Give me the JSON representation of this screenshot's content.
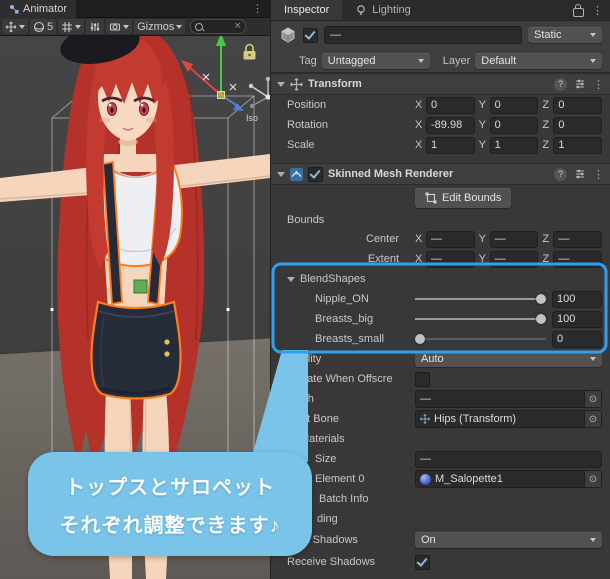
{
  "window": {
    "animator_tab": "Animator",
    "gizmos_label": "Gizmos",
    "toolbar_count": "5"
  },
  "scene": {
    "iso_label": "Iso",
    "bubble_line1": "トップスとサロペット",
    "bubble_line2": "それぞれ調整できます♪"
  },
  "icons": {
    "kebab": "⋮",
    "help": "?",
    "picker": "⊙",
    "close": "×"
  },
  "inspector": {
    "tab_inspector": "Inspector",
    "tab_lighting": "Lighting",
    "header": {
      "name": "—",
      "static": "Static",
      "tag_label": "Tag",
      "tag_value": "Untagged",
      "layer_label": "Layer",
      "layer_value": "Default"
    },
    "axes": {
      "x": "X",
      "y": "Y",
      "z": "Z"
    },
    "transform": {
      "title": "Transform",
      "position": {
        "label": "Position",
        "x": "0",
        "y": "0",
        "z": "0"
      },
      "rotation": {
        "label": "Rotation",
        "x": "-89.98",
        "y": "0",
        "z": "0"
      },
      "scale": {
        "label": "Scale",
        "x": "1",
        "y": "1",
        "z": "1"
      }
    },
    "smr": {
      "title": "Skinned Mesh Renderer",
      "edit_bounds": "Edit Bounds",
      "bounds": "Bounds",
      "center": {
        "label": "Center",
        "x": "—",
        "y": "—",
        "z": "—"
      },
      "extent": {
        "label": "Extent",
        "x": "—",
        "y": "—",
        "z": "—"
      },
      "blendshapes_title": "BlendShapes",
      "sliders": [
        {
          "label": "Nipple_ON",
          "value": "100",
          "pct": 100
        },
        {
          "label": "Breasts_big",
          "value": "100",
          "pct": 100
        },
        {
          "label": "Breasts_small",
          "value": "0",
          "pct": 0
        }
      ],
      "quality_label": "Quality",
      "quality_value": "Auto",
      "update_label": "Update When Offscre",
      "mesh_label": "Mesh",
      "mesh_value": "—",
      "rootbone_label": "Root Bone",
      "rootbone_value": "Hips (Transform)",
      "materials_label": "Materials",
      "size_label": "Size",
      "size_value": "—",
      "element0_label": "Element 0",
      "element0_value": "M_Salopette1",
      "batch_fragment": "Batch Info",
      "row_fragment": "ding",
      "cast_label": "Cast Shadows",
      "cast_value": "On",
      "receive_label": "Receive Shadows"
    }
  },
  "colors": {
    "highlight": "#2f9ff2",
    "bubble": "#79c4e8",
    "selection_outline": "#ff7c1d"
  }
}
